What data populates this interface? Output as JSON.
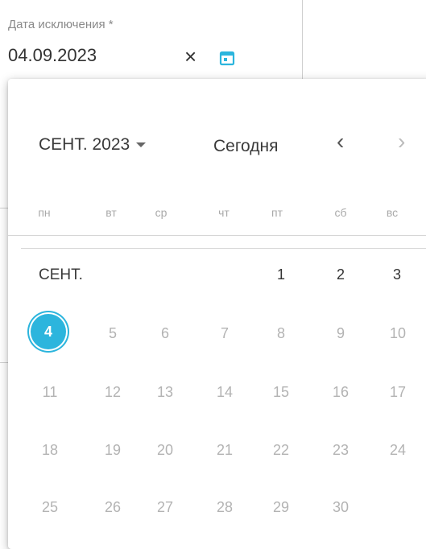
{
  "field": {
    "label": "Дата исключения *",
    "value": "04.09.2023",
    "clear_symbol": "×"
  },
  "picker": {
    "month_select": "СЕНТ. 2023",
    "today_label": "Сегодня",
    "prev_symbol": "‹",
    "next_symbol": "›",
    "weekdays": [
      "пн",
      "вт",
      "ср",
      "чт",
      "пт",
      "сб",
      "вс"
    ],
    "month_label": "СЕНТ.",
    "selected_day": "4",
    "row1": [
      "1",
      "2",
      "3"
    ],
    "row2": [
      "5",
      "6",
      "7",
      "8",
      "9",
      "10"
    ],
    "row3": [
      "11",
      "12",
      "13",
      "14",
      "15",
      "16",
      "17"
    ],
    "row4": [
      "18",
      "19",
      "20",
      "21",
      "22",
      "23",
      "24"
    ],
    "row5": [
      "25",
      "26",
      "27",
      "28",
      "29",
      "30"
    ]
  },
  "colors": {
    "accent": "#2cb5dd",
    "text": "#333333",
    "muted": "#b3b3b3"
  },
  "icons": {
    "calendar": "calendar-icon",
    "clear": "close-icon",
    "caret": "caret-down-icon",
    "prev": "chevron-left-icon",
    "next": "chevron-right-icon"
  }
}
